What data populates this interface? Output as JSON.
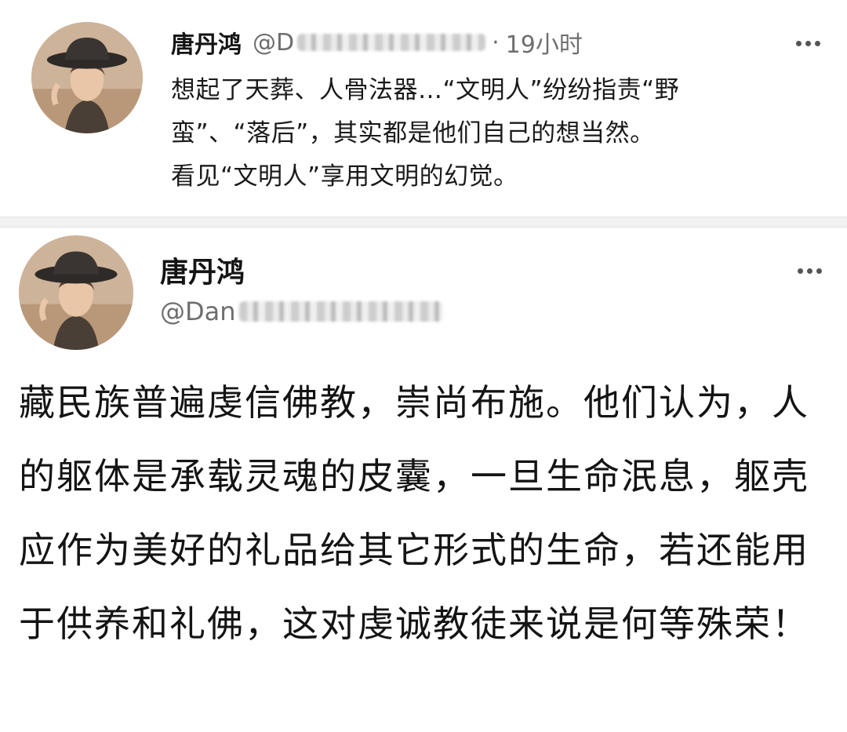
{
  "post1": {
    "author_name": "唐丹鸿",
    "handle_prefix": "@D",
    "separator": "·",
    "time": "19小时",
    "lines": [
      "想起了天葬、人骨法器…“文明人”纷纷指责“野",
      "蛮”、“落后”，其实都是他们自己的想当然。",
      "看见“文明人”享用文明的幻觉。"
    ],
    "more_icon": "more-horizontal-icon"
  },
  "post2": {
    "author_name": "唐丹鸿",
    "handle_prefix": "@Dan",
    "body": "藏民族普遍虔信佛教，崇尚布施。他们认为，人的躯体是承载灵魂的皮囊，一旦生命泯息，躯壳应作为美好的礼品给其它形式的生命，若还能用于供养和礼佛，这对虔诚教徒来说是何等殊荣！",
    "more_icon": "more-horizontal-icon"
  },
  "colors": {
    "text": "#141414",
    "secondary_text": "#6e6e6e",
    "divider": "#f1f1f1"
  }
}
